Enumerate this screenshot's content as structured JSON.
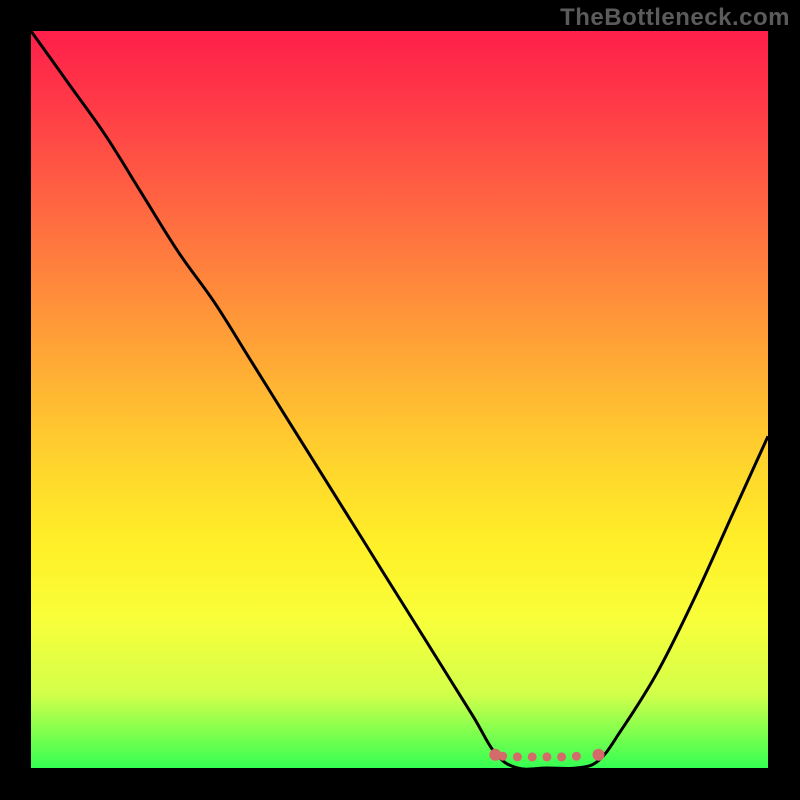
{
  "watermark": "TheBottleneck.com",
  "chart_data": {
    "type": "line",
    "title": "",
    "xlabel": "",
    "ylabel": "",
    "xlim": [
      0,
      100
    ],
    "ylim": [
      0,
      100
    ],
    "x": [
      0,
      5,
      10,
      15,
      20,
      25,
      30,
      35,
      40,
      45,
      50,
      55,
      60,
      63,
      66,
      70,
      74,
      77,
      80,
      85,
      90,
      95,
      100
    ],
    "values": [
      100,
      93,
      86,
      78,
      70,
      63,
      55,
      47,
      39,
      31,
      23,
      15,
      7,
      2,
      0,
      0,
      0,
      1,
      5,
      13,
      23,
      34,
      45
    ],
    "dots": {
      "x": [
        63,
        64,
        66,
        68,
        70,
        72,
        74,
        77
      ],
      "y": [
        1.8,
        1.6,
        1.5,
        1.5,
        1.5,
        1.5,
        1.6,
        1.8
      ],
      "color": "#d46a6a"
    },
    "gradient_stops": [
      {
        "pos": 0,
        "color": "#ff1f4a"
      },
      {
        "pos": 10,
        "color": "#ff3a47"
      },
      {
        "pos": 20,
        "color": "#ff5a43"
      },
      {
        "pos": 30,
        "color": "#ff7a3e"
      },
      {
        "pos": 40,
        "color": "#ff9a38"
      },
      {
        "pos": 50,
        "color": "#ffba32"
      },
      {
        "pos": 60,
        "color": "#ffd82c"
      },
      {
        "pos": 70,
        "color": "#fff028"
      },
      {
        "pos": 80,
        "color": "#f8ff3a"
      },
      {
        "pos": 90,
        "color": "#d2ff4a"
      },
      {
        "pos": 100,
        "color": "#34ff52"
      }
    ]
  }
}
